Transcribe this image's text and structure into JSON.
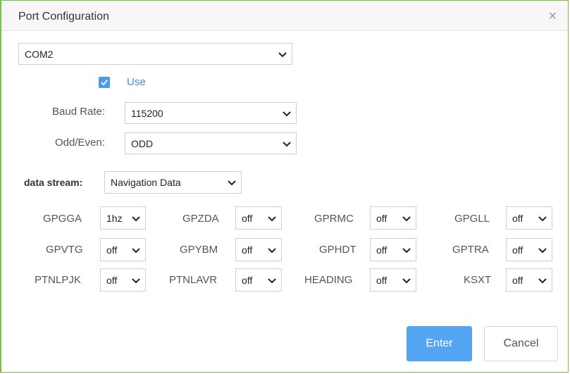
{
  "dialog": {
    "title": "Port Configuration",
    "close_glyph": "×"
  },
  "port": {
    "value": "COM2"
  },
  "use": {
    "label": "Use",
    "checked": true
  },
  "baud": {
    "label": "Baud Rate:",
    "value": "115200"
  },
  "parity": {
    "label": "Odd/Even:",
    "value": "ODD"
  },
  "stream": {
    "label": "data stream:",
    "value": "Navigation Data"
  },
  "sentences": [
    {
      "name": "GPGGA",
      "value": "1hz"
    },
    {
      "name": "GPZDA",
      "value": "off"
    },
    {
      "name": "GPRMC",
      "value": "off"
    },
    {
      "name": "GPGLL",
      "value": "off"
    },
    {
      "name": "GPVTG",
      "value": "off"
    },
    {
      "name": "GPYBM",
      "value": "off"
    },
    {
      "name": "GPHDT",
      "value": "off"
    },
    {
      "name": "GPTRA",
      "value": "off"
    },
    {
      "name": "PTNLPJK",
      "value": "off"
    },
    {
      "name": "PTNLAVR",
      "value": "off"
    },
    {
      "name": "HEADING",
      "value": "off"
    },
    {
      "name": "KSXT",
      "value": "off"
    }
  ],
  "buttons": {
    "enter": "Enter",
    "cancel": "Cancel"
  },
  "colors": {
    "accent": "#54a6f5",
    "border": "#7dbb4f",
    "checkbox": "#4a9be8"
  },
  "icons": {
    "close": "close-icon",
    "dropdown": "chevron-down-icon",
    "check": "check-icon"
  }
}
